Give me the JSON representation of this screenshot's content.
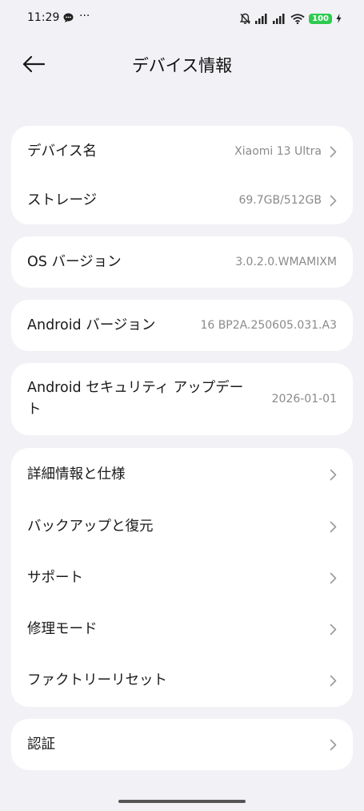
{
  "status_bar": {
    "time": "11:29",
    "more": "···",
    "battery": "100",
    "battery_color": "#2ecb4f"
  },
  "header": {
    "title": "デバイス情報"
  },
  "cards": {
    "device": {
      "name_label": "デバイス名",
      "name_value": "Xiaomi 13 Ultra",
      "storage_label": "ストレージ",
      "storage_value": "69.7GB/512GB"
    },
    "os": {
      "label": "OS バージョン",
      "value": "3.0.2.0.WMAMIXM"
    },
    "android": {
      "label": "Android バージョン",
      "value": "16 BP2A.250605.031.A3"
    },
    "security": {
      "label_line1": "Android セキュリティ アップデー",
      "label_line2": "ト",
      "value": "2026-01-01"
    },
    "menu": {
      "items": [
        {
          "label": "詳細情報と仕様"
        },
        {
          "label": "バックアップと復元"
        },
        {
          "label": "サポート"
        },
        {
          "label": "修理モード"
        },
        {
          "label": "ファクトリーリセット"
        }
      ]
    },
    "cert": {
      "label": "認証"
    }
  }
}
